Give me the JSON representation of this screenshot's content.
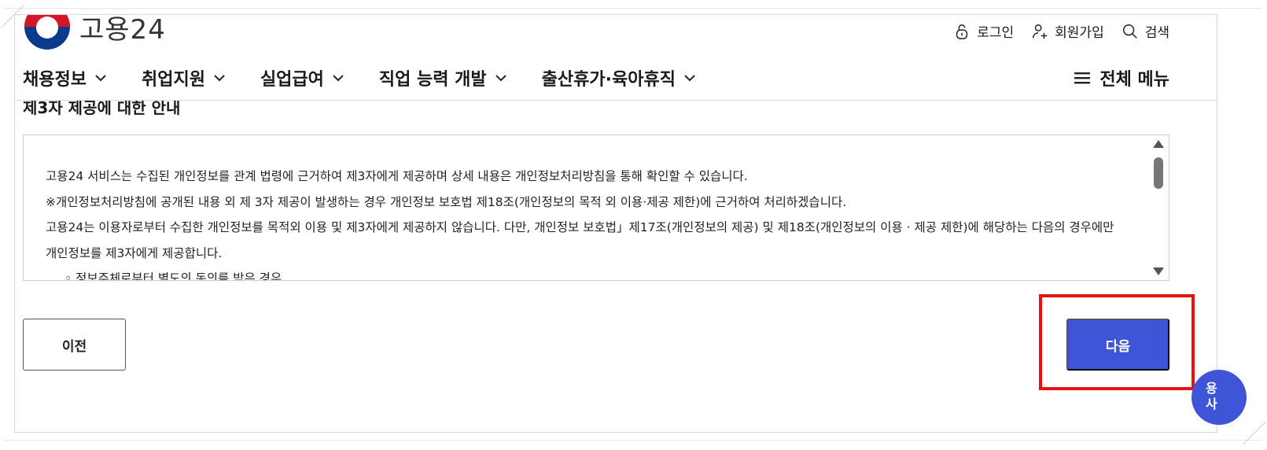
{
  "header": {
    "logo_text": "고용24",
    "util": {
      "login": "로그인",
      "signup": "회원가입",
      "search": "검색"
    },
    "nav": [
      {
        "label": "채용정보"
      },
      {
        "label": "취업지원"
      },
      {
        "label": "실업급여"
      },
      {
        "label": "직업 능력 개발"
      },
      {
        "label": "출산휴가·육아휴직"
      }
    ],
    "all_menu": "전체 메뉴"
  },
  "section": {
    "title": "제3자 제공에 대한 안내"
  },
  "terms": {
    "lines": [
      "고용24 서비스는 수집된 개인정보를 관계 법령에 근거하여 제3자에게 제공하며 상세 내용은 개인정보처리방침을 통해 확인할 수 있습니다.",
      "※개인정보처리방침에 공개된 내용 외 제 3자 제공이 발생하는 경우 개인정보 보호법 제18조(개인정보의 목적 외 이용·제공 제한)에 근거하여 처리하겠습니다.",
      "고용24는 이용자로부터 수집한 개인정보를 목적외 이용 및 제3자에게 제공하지 않습니다. 다만, 개인정보 보호법」제17조(개인정보의 제공) 및 제18조(개인정보의 이용 · 제공 제한)에 해당하는 다음의 경우에만 개인정보를 제3자에게 제공합니다.",
      "  ◦ 정보주체로부터 별도의 동의를 받은 경우"
    ]
  },
  "buttons": {
    "prev": "이전",
    "next": "다음"
  },
  "floating": {
    "line1": "용",
    "line2": "사"
  },
  "colors": {
    "primary": "#3d55d6",
    "highlight": "#e81212"
  }
}
